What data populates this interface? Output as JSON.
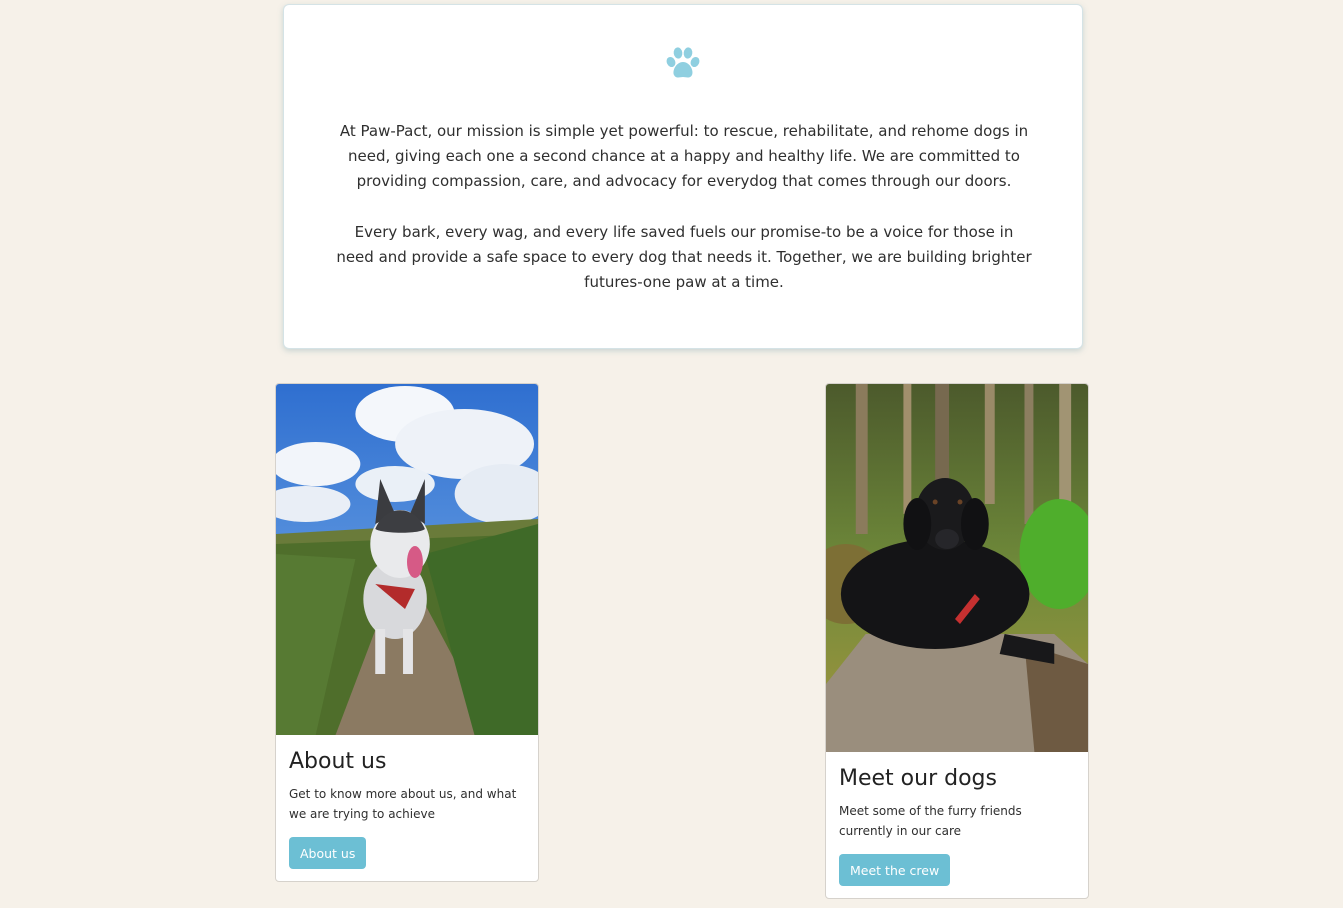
{
  "mission": {
    "icon": "paw-icon",
    "paragraph_1": "At Paw-Pact, our mission is simple yet powerful: to rescue, rehabilitate, and rehome dogs in need, giving each one a second chance at a happy and healthy life. We are committed to providing compassion, care, and advocacy for everydog that comes through our doors.",
    "paragraph_2": "Every bark, every wag, and every life saved fuels our promise-to be a voice for those in need and provide a safe space to every dog that needs it. Together, we are building brighter futures-one paw at a time."
  },
  "cards": [
    {
      "title": "About us",
      "text": "Get to know more about us, and what we are trying to achieve",
      "button_label": "About us",
      "image": "husky-on-grassy-path-photo"
    },
    {
      "title": "Meet our dogs",
      "text": "Meet some of the furry friends currently in our care",
      "button_label": "Meet the crew",
      "image": "black-dog-on-log-photo"
    }
  ],
  "colors": {
    "background": "#f6f1e9",
    "accent": "#6cbfd4",
    "paw_icon": "#8fcfe0"
  }
}
